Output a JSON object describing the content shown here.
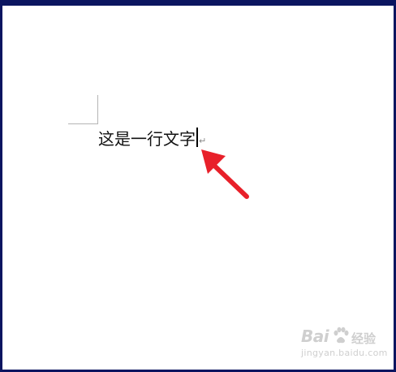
{
  "document": {
    "text": "这是一行文字",
    "paragraph_mark": "↵"
  },
  "watermark": {
    "brand": "Bai",
    "product": "经验",
    "url": "jingyan.baidu.com"
  },
  "colors": {
    "frame": "#0b1560",
    "arrow": "#e8202a",
    "watermark": "#cfcfcf"
  },
  "icons": {
    "annotation": "red-arrow-icon",
    "watermark_logo": "baidu-paw-icon"
  }
}
